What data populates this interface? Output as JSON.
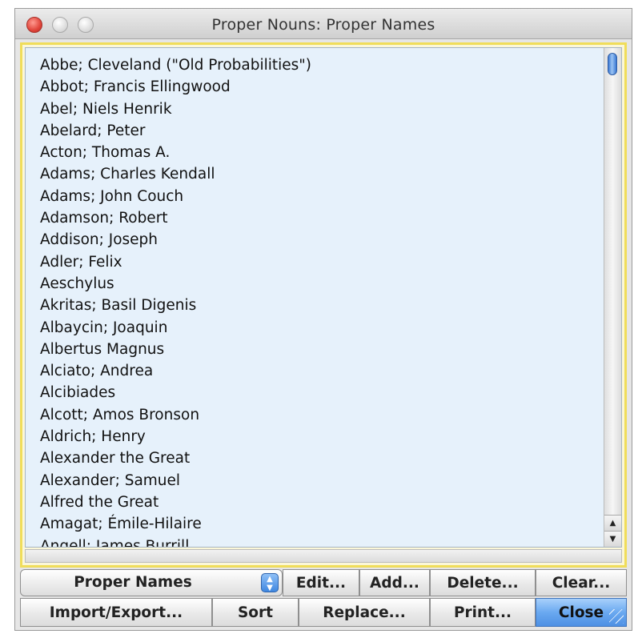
{
  "window": {
    "title": "Proper Nouns: Proper Names"
  },
  "list": {
    "items": [
      "Abbe; Cleveland (\"Old Probabilities\")",
      "Abbot; Francis Ellingwood",
      "Abel; Niels Henrik",
      "Abelard; Peter",
      "Acton; Thomas A.",
      "Adams; Charles Kendall",
      "Adams; John Couch",
      "Adamson; Robert",
      "Addison; Joseph",
      "Adler; Felix",
      "Aeschylus",
      "Akritas; Basil Digenis",
      "Albaycin; Joaquin",
      "Albertus Magnus",
      "Alciato; Andrea",
      "Alcibiades",
      "Alcott; Amos Bronson",
      "Aldrich; Henry",
      "Alexander the Great",
      "Alexander; Samuel",
      "Alfred the Great",
      "Amagat; Émile-Hilaire",
      "Angell; James Burrill"
    ]
  },
  "toolbar": {
    "selector_value": "Proper Names",
    "edit_label": "Edit...",
    "add_label": "Add...",
    "delete_label": "Delete...",
    "clear_label": "Clear...",
    "import_export_label": "Import/Export...",
    "sort_label": "Sort",
    "replace_label": "Replace...",
    "print_label": "Print...",
    "close_label": "Close"
  },
  "colors": {
    "list_background": "#e6f1fb",
    "focus_ring": "#f0dd5a",
    "default_button": "#6aa9f0"
  }
}
